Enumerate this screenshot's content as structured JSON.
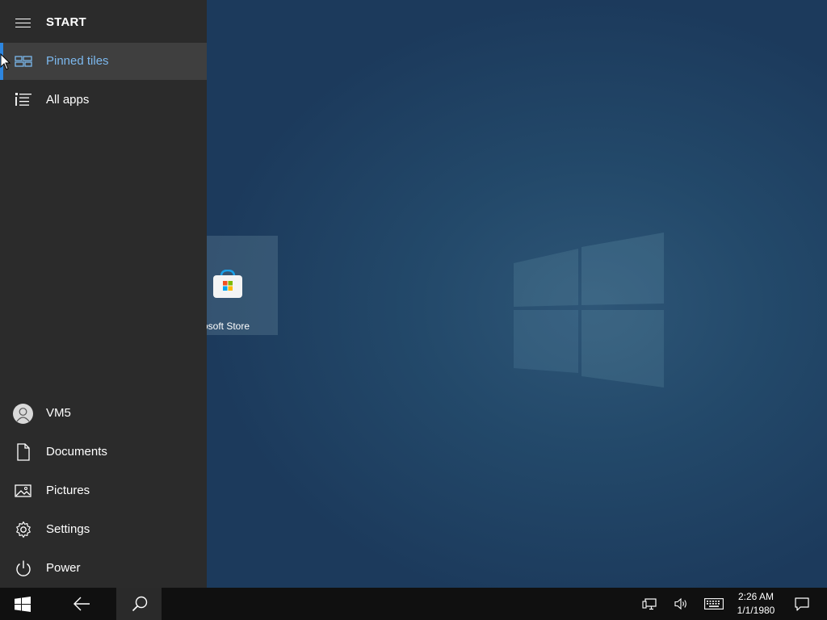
{
  "start": {
    "title": "START",
    "nav": {
      "pinned_tiles": "Pinned tiles",
      "all_apps": "All apps"
    },
    "bottom": {
      "user": "VM5",
      "documents": "Documents",
      "pictures": "Pictures",
      "settings": "Settings",
      "power": "Power"
    }
  },
  "tiles": [
    {
      "label": "Microsoft Store",
      "visible_label": "osoft Store",
      "icon": "microsoft-store-icon"
    }
  ],
  "taskbar": {
    "time": "2:26 AM",
    "date": "1/1/1980",
    "icons": [
      "windows-start-icon",
      "back-arrow-icon",
      "search-icon",
      "network-icon",
      "volume-icon",
      "touch-keyboard-icon",
      "action-center-icon"
    ]
  },
  "colors": {
    "accent": "#2d86e0",
    "selected_text": "#7cb8ee",
    "pane_bg": "#2b2b2b",
    "taskbar_bg": "#101010",
    "desktop_bg": "#1c3a5c"
  }
}
